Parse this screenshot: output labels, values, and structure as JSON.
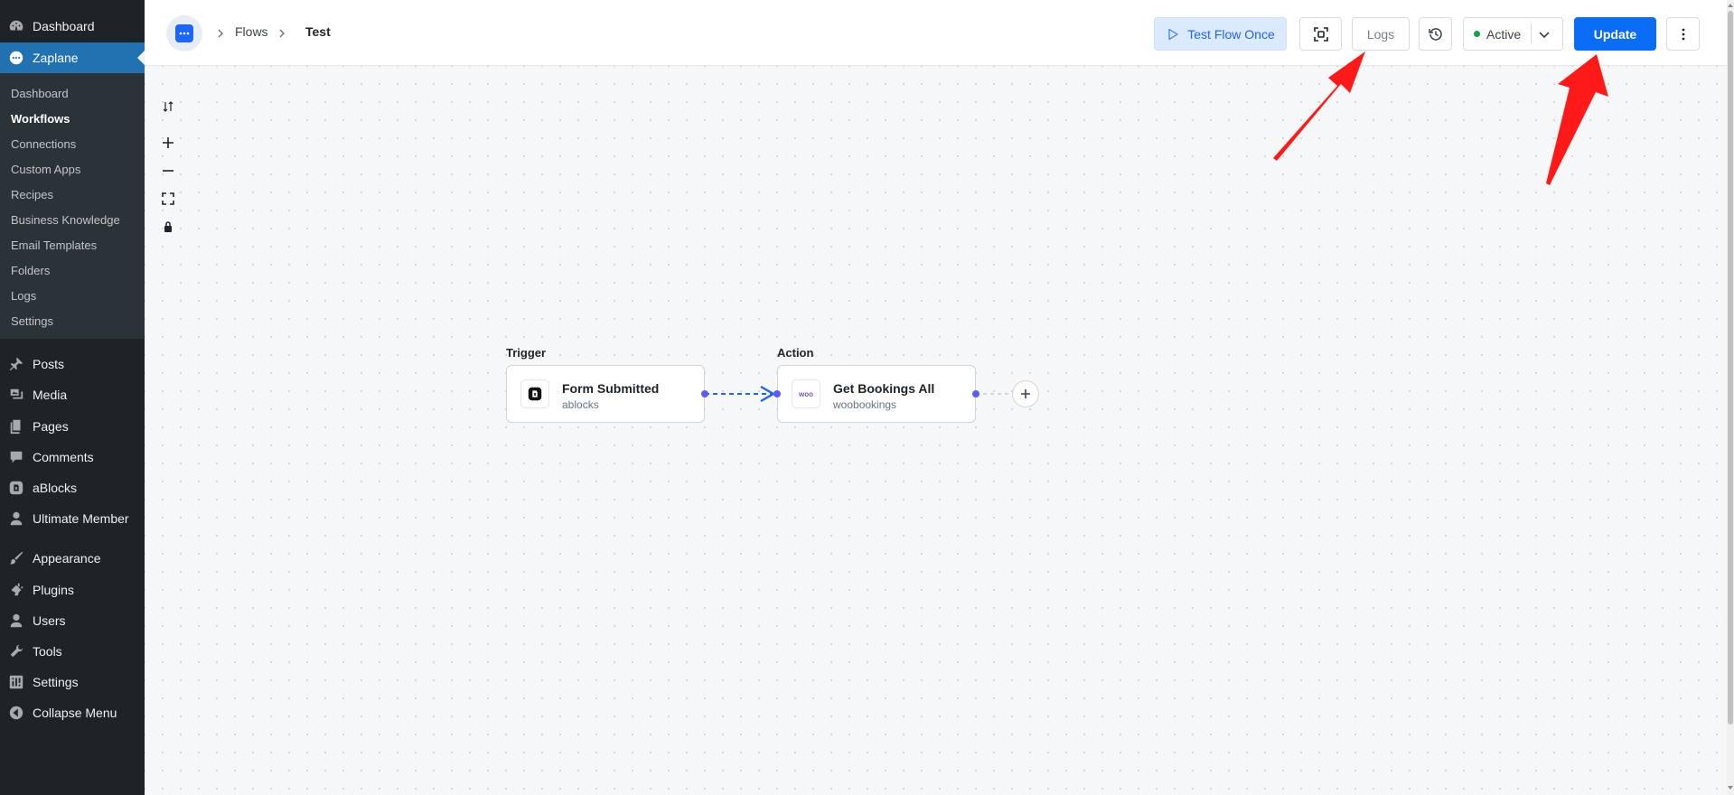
{
  "sidebar": {
    "items": [
      {
        "label": "Dashboard",
        "icon": "dashboard-icon"
      },
      {
        "label": "Zaplane",
        "icon": "zaplane-icon",
        "current": true
      },
      {
        "label": "Posts",
        "icon": "pin-icon"
      },
      {
        "label": "Media",
        "icon": "media-icon"
      },
      {
        "label": "Pages",
        "icon": "pages-icon"
      },
      {
        "label": "Comments",
        "icon": "comment-icon"
      },
      {
        "label": "aBlocks",
        "icon": "ablocks-icon"
      },
      {
        "label": "Ultimate Member",
        "icon": "user-icon"
      },
      {
        "label": "Appearance",
        "icon": "brush-icon"
      },
      {
        "label": "Plugins",
        "icon": "plug-icon"
      },
      {
        "label": "Users",
        "icon": "user-icon"
      },
      {
        "label": "Tools",
        "icon": "wrench-icon"
      },
      {
        "label": "Settings",
        "icon": "settings-icon"
      },
      {
        "label": "Collapse Menu",
        "icon": "collapse-icon"
      }
    ],
    "submenu": [
      {
        "label": "Dashboard"
      },
      {
        "label": "Workflows",
        "active": true
      },
      {
        "label": "Connections"
      },
      {
        "label": "Custom Apps"
      },
      {
        "label": "Recipes"
      },
      {
        "label": "Business Knowledge"
      },
      {
        "label": "Email Templates"
      },
      {
        "label": "Folders"
      },
      {
        "label": "Logs"
      },
      {
        "label": "Settings"
      }
    ]
  },
  "header": {
    "breadcrumb": [
      "Flows",
      "Test"
    ],
    "test_label": "Test Flow Once",
    "logs_label": "Logs",
    "status_label": "Active",
    "status_color": "#16a34a",
    "update_label": "Update",
    "accent": "#0b6cf6"
  },
  "flow": {
    "trigger": {
      "caption": "Trigger",
      "title": "Form Submitted",
      "subtitle": "ablocks"
    },
    "action": {
      "caption": "Action",
      "title": "Get Bookings All",
      "subtitle": "woobookings",
      "icon_text": "woo"
    }
  }
}
